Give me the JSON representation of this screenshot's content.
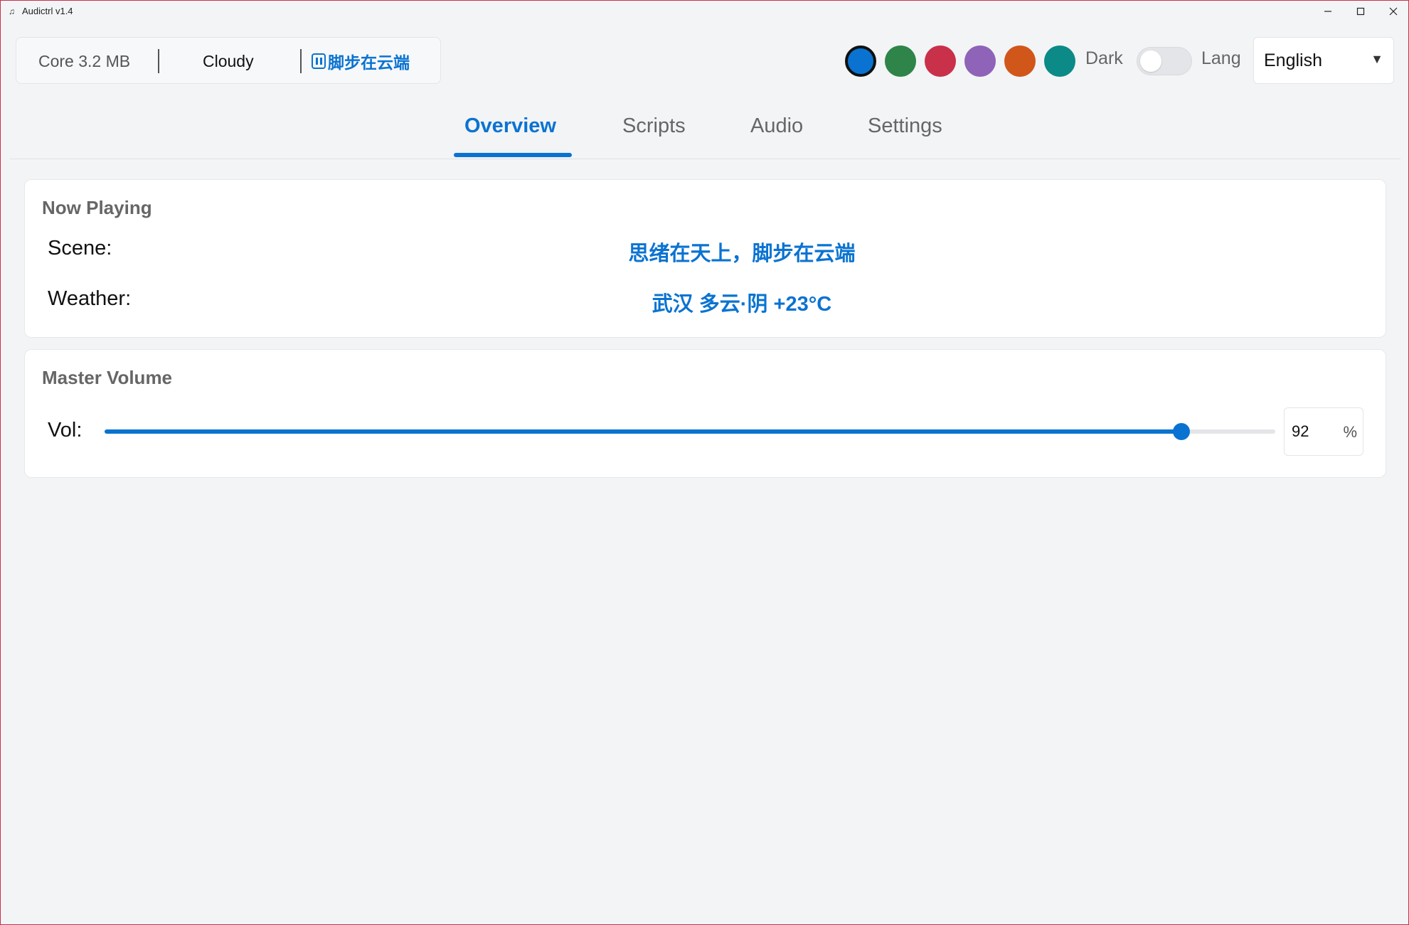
{
  "window": {
    "title": "Audictrl v1.4",
    "app_icon": "music-note-icon",
    "controls": [
      "minimize-icon",
      "maximize-icon",
      "close-icon"
    ]
  },
  "info_bar": {
    "core": "Core 3.2 MB",
    "weather": "Cloudy",
    "now_playing_short": "脚步在云端",
    "playback_icon": "pause-icon"
  },
  "theme": {
    "swatches": [
      "#0a73d1",
      "#2e8449",
      "#c9304a",
      "#8f63b8",
      "#d1561a",
      "#0b8a87"
    ],
    "selected_swatch": 0,
    "dark_label": "Dark",
    "dark_enabled": false,
    "lang_label": "Lang",
    "language": "English"
  },
  "tabs": [
    {
      "label": "Overview",
      "active": true
    },
    {
      "label": "Scripts",
      "active": false
    },
    {
      "label": "Audio",
      "active": false
    },
    {
      "label": "Settings",
      "active": false
    }
  ],
  "now_playing": {
    "title": "Now Playing",
    "scene_label": "Scene:",
    "scene_value": "思绪在天上，脚步在云端",
    "weather_label": "Weather:",
    "weather_value": "武汉 多云·阴 +23°C"
  },
  "master_volume": {
    "title": "Master Volume",
    "label": "Vol:",
    "value": 92,
    "unit": "%"
  },
  "colors": {
    "accent": "#0a73d1",
    "window_border": "#c8304a",
    "background": "#f3f4f6"
  }
}
